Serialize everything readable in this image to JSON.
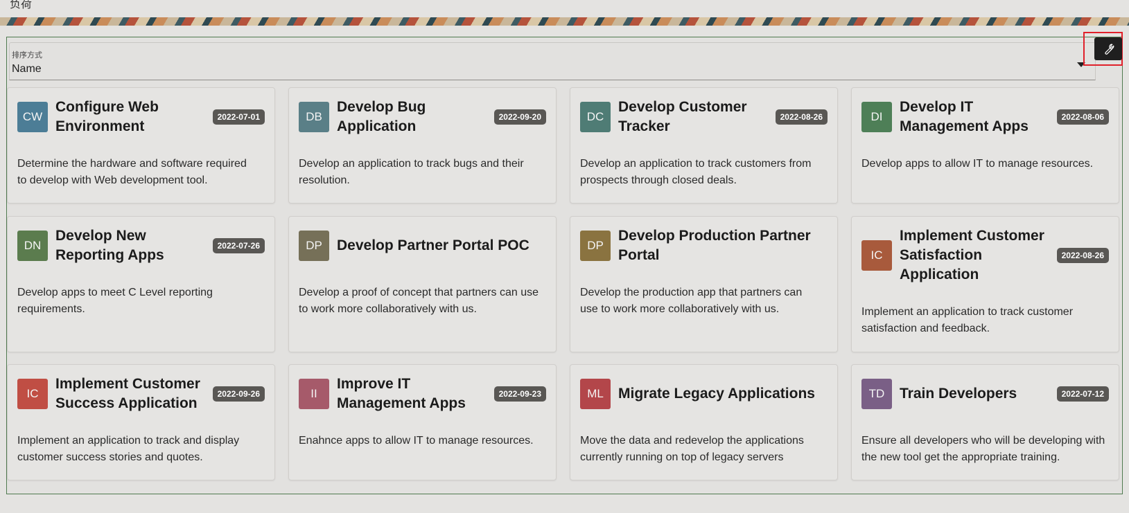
{
  "page": {
    "title": "负荷"
  },
  "sort": {
    "label": "排序方式",
    "value": "Name"
  },
  "colors": {
    "region_border": "#4f7a4f",
    "badge_bg": "#595754",
    "highlight": "#e0202a"
  },
  "toolbar": {
    "icon": "wrench-icon"
  },
  "cards": [
    {
      "initials": "CW",
      "color": "#4c7d96",
      "title_lines": [
        "Configure Web",
        "Environment"
      ],
      "date": "2022-07-01",
      "desc_lines": [
        "Determine the hardware and software required",
        "to develop with Web development tool."
      ]
    },
    {
      "initials": "DB",
      "color": "#5a7f87",
      "title_lines": [
        "Develop Bug",
        "Application"
      ],
      "date": "2022-09-20",
      "desc_lines": [
        "Develop an application to track bugs and their",
        "resolution."
      ]
    },
    {
      "initials": "DC",
      "color": "#4f7c75",
      "title_lines": [
        "Develop Customer",
        "Tracker"
      ],
      "date": "2022-08-26",
      "desc_lines": [
        "Develop an application to track customers from",
        "prospects through closed deals."
      ]
    },
    {
      "initials": "DI",
      "color": "#4e7f57",
      "title_lines": [
        "Develop IT",
        "Management Apps"
      ],
      "date": "2022-08-06",
      "desc_lines": [
        "Develop apps to allow IT to manage resources."
      ]
    },
    {
      "initials": "DN",
      "color": "#5b7c4e",
      "title_lines": [
        "Develop New",
        "Reporting Apps"
      ],
      "date": "2022-07-26",
      "desc_lines": [
        "Develop apps to meet C Level reporting",
        "requirements."
      ]
    },
    {
      "initials": "DP",
      "color": "#767058",
      "title_lines": [
        "Develop Partner Portal POC"
      ],
      "date": "",
      "desc_lines": [
        "Develop a proof of concept that partners can use",
        "to work more collaboratively with us."
      ]
    },
    {
      "initials": "DP",
      "color": "#8a7340",
      "title_lines": [
        "Develop Production Partner",
        "Portal"
      ],
      "date": "",
      "desc_lines": [
        "Develop the production app that partners can",
        "use to work more collaboratively with us."
      ]
    },
    {
      "initials": "IC",
      "color": "#a85a3c",
      "title_lines": [
        "Implement Customer",
        "Satisfaction",
        "Application"
      ],
      "date": "2022-08-26",
      "desc_lines": [
        "Implement an application to track customer",
        "satisfaction and feedback."
      ]
    },
    {
      "initials": "IC",
      "color": "#c04e44",
      "title_lines": [
        "Implement Customer",
        "Success Application"
      ],
      "date": "2022-09-26",
      "desc_lines": [
        "Implement an application to track and display",
        "customer success stories and quotes."
      ]
    },
    {
      "initials": "II",
      "color": "#a65a6a",
      "title_lines": [
        "Improve IT",
        "Management Apps"
      ],
      "date": "2022-09-23",
      "desc_lines": [
        "Enahnce apps to allow IT to manage resources."
      ]
    },
    {
      "initials": "ML",
      "color": "#b3464a",
      "title_lines": [
        "Migrate Legacy Applications"
      ],
      "date": "",
      "desc_lines": [
        "Move the data and redevelop the applications",
        "currently running on top of legacy servers"
      ]
    },
    {
      "initials": "TD",
      "color": "#7a5f86",
      "title_lines": [
        "Train Developers"
      ],
      "date": "2022-07-12",
      "desc_lines": [
        "Ensure all developers who will be developing with",
        "the new tool get the appropriate training."
      ]
    }
  ]
}
